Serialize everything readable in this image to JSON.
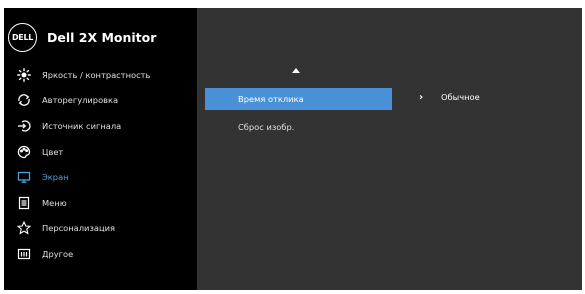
{
  "header": {
    "logo_text": "DELL",
    "title": "Dell 2X Monitor"
  },
  "menu": [
    {
      "label": "Яркость / контрастность",
      "icon": "brightness-icon"
    },
    {
      "label": "Авторегулировка",
      "icon": "auto-adjust-icon"
    },
    {
      "label": "Источник сигнала",
      "icon": "input-source-icon"
    },
    {
      "label": "Цвет",
      "icon": "color-palette-icon"
    },
    {
      "label": "Экран",
      "icon": "display-icon",
      "active": true
    },
    {
      "label": "Меню",
      "icon": "menu-icon"
    },
    {
      "label": "Персонализация",
      "icon": "star-icon"
    },
    {
      "label": "Другое",
      "icon": "other-icon"
    }
  ],
  "panel": {
    "options": [
      {
        "label": "Время отклика",
        "selected": true,
        "value": "Обычное"
      },
      {
        "label": "Сброс изобр."
      }
    ],
    "chevron": "›"
  },
  "colors": {
    "accent": "#4aa3df",
    "selection": "#4a90d6",
    "sidebar_bg": "#000000",
    "panel_bg": "#333333"
  }
}
